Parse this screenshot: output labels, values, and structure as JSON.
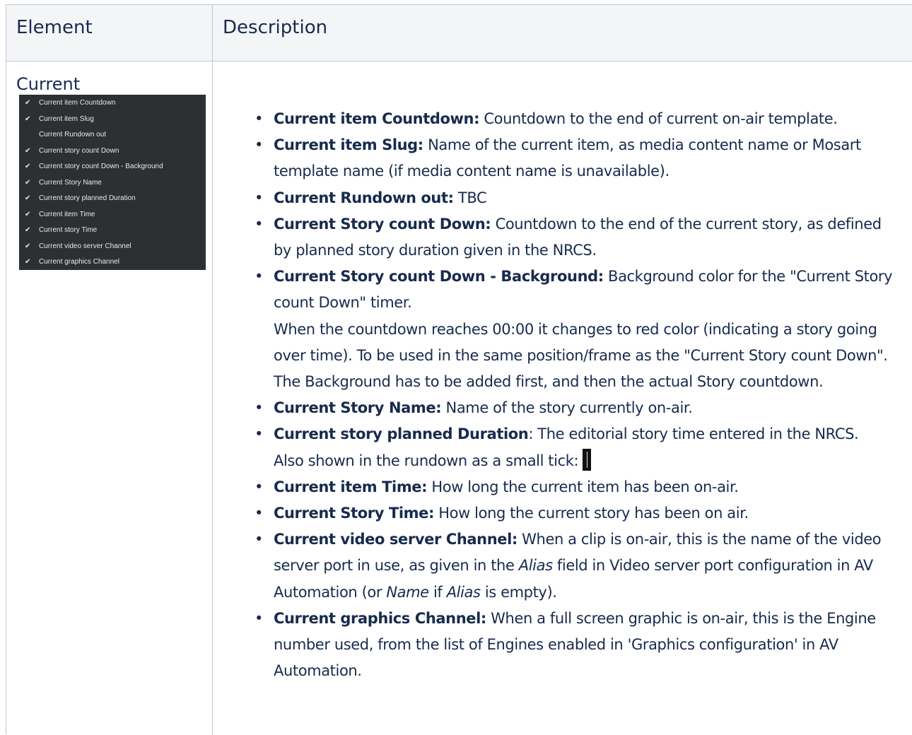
{
  "table": {
    "headers": {
      "element": "Element",
      "description": "Description"
    }
  },
  "row": {
    "element_title": "Current",
    "menu_items": [
      {
        "label": "Current item Countdown",
        "checked": "✔"
      },
      {
        "label": "Current item Slug",
        "checked": "✔"
      },
      {
        "label": "Current Rundown out",
        "checked": ""
      },
      {
        "label": "Current story count Down",
        "checked": "✔"
      },
      {
        "label": "Current story count Down - Background",
        "checked": "✔"
      },
      {
        "label": "Current Story Name",
        "checked": "✔"
      },
      {
        "label": "Current story planned Duration",
        "checked": "✔"
      },
      {
        "label": "Current item Time",
        "checked": "✔"
      },
      {
        "label": "Current story Time",
        "checked": "✔"
      },
      {
        "label": "Current video server Channel",
        "checked": "✔"
      },
      {
        "label": "Current graphics Channel",
        "checked": "✔"
      }
    ],
    "descriptions": {
      "countdown": {
        "term": "Current item Countdown:",
        "text": " Countdown to the end of current on-air template."
      },
      "slug": {
        "term": "Current item Slug:",
        "text": " Name of the current item, as media content name or Mosart template name (if media content name is unavailable)."
      },
      "rundown_out": {
        "term": "Current Rundown out:",
        "text": " TBC"
      },
      "story_countdown": {
        "term": "Current Story count Down:",
        "text": " Countdown to the end of the current story, as defined by planned story duration given in the NRCS."
      },
      "story_countdown_bg": {
        "term": "Current Story count Down - Background:",
        "text": " Background color for the \"Current Story count Down\" timer.",
        "text2": "When the countdown reaches 00:00 it changes to red color (indicating a story going over time). To be used in the same position/frame as the \"Current Story count Down\". The Background has to be added first, and then the actual Story countdown."
      },
      "story_name": {
        "term": "Current Story Name:",
        "text": " Name of the story currently on-air."
      },
      "planned_duration": {
        "term": "Current story planned Duration",
        "text": ": The editorial story time entered in the NRCS.",
        "text2": "Also shown in the rundown as a small tick:"
      },
      "item_time": {
        "term": "Current item Time:",
        "text": " How long the current item has been on-air."
      },
      "story_time": {
        "term": "Current Story Time:",
        "text": " How long the current story has been on air."
      },
      "video_channel": {
        "term": "Current video server Channel:",
        "text_a": " When a clip is on-air, this is the name of the video server port in use, as given in the ",
        "alias": "Alias",
        "text_b": " field in Video server port configuration in AV Automation (or ",
        "name": "Name",
        "text_c": " if ",
        "alias2": "Alias",
        "text_d": " is empty)."
      },
      "graphics_channel": {
        "term": "Current graphics Channel:",
        "text": " When a full screen graphic is on-air, this is the Engine number used, from the list of Engines enabled in 'Graphics configuration' in AV Automation."
      }
    },
    "bullet": "•"
  }
}
